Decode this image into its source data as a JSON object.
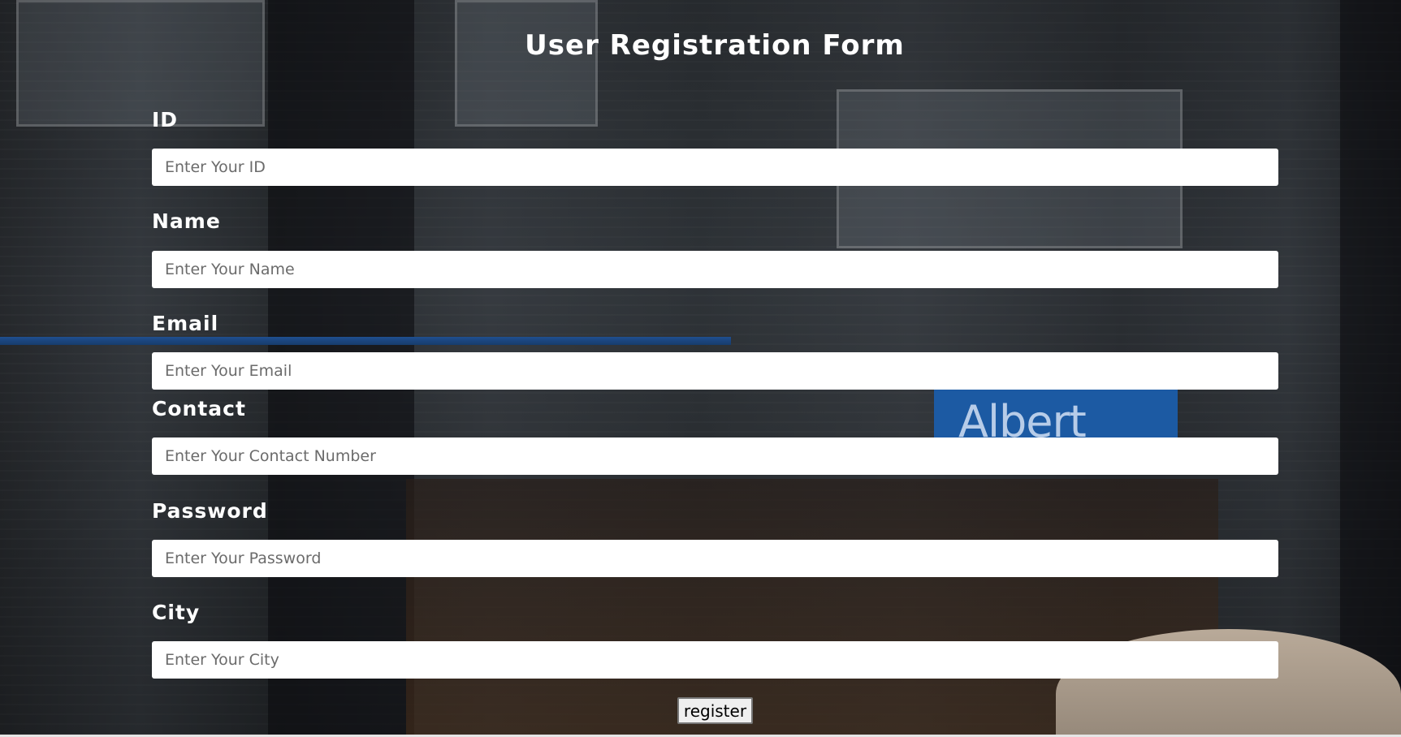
{
  "form": {
    "title": "User Registration Form",
    "fields": [
      {
        "label": "ID",
        "placeholder": "Enter Your ID"
      },
      {
        "label": "Name",
        "placeholder": "Enter Your Name"
      },
      {
        "label": "Email",
        "placeholder": "Enter Your Email"
      },
      {
        "label": "Contact",
        "placeholder": "Enter Your Contact Number"
      },
      {
        "label": "Password",
        "placeholder": "Enter Your Password"
      },
      {
        "label": "City",
        "placeholder": "Enter Your City"
      }
    ],
    "submit_label": "register"
  },
  "background": {
    "sign_text": "Albert Heijn"
  }
}
